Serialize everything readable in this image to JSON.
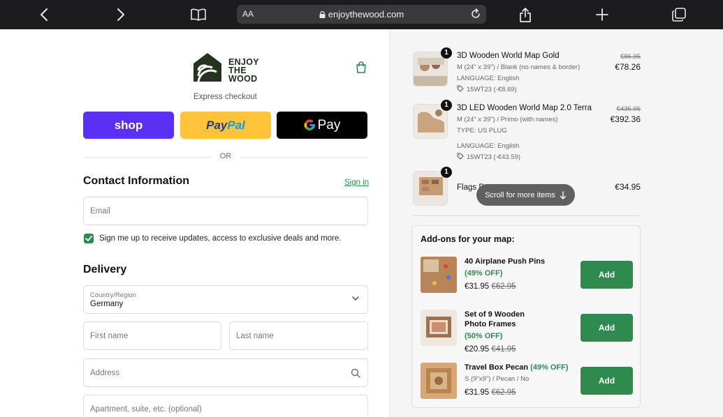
{
  "browser": {
    "text_size": "AA",
    "domain": "enjoythewood.com"
  },
  "header": {
    "logo_lines": [
      "ENJOY",
      "THE",
      "WOOD"
    ]
  },
  "express": {
    "label": "Express checkout",
    "shop": "shop",
    "paypal_a": "Pay",
    "paypal_b": "Pal",
    "gpay": "Pay",
    "or": "OR"
  },
  "contact": {
    "title": "Contact Information",
    "sign_in": "Sign in",
    "email_placeholder": "Email",
    "newsletter": "Sign me up to receive updates, access to exclusive deals and more."
  },
  "delivery": {
    "title": "Delivery",
    "country_label": "Country/Region",
    "country_value": "Germany",
    "first_name": "First name",
    "last_name": "Last name",
    "address": "Address",
    "apartment": "Apartment, suite, etc. (optional)"
  },
  "order": {
    "items": [
      {
        "qty": "1",
        "title": "3D Wooden World Map Gold",
        "variant": "M (24\" x 39\") / Blank (no names & border)",
        "language": "LANGUAGE: English",
        "discount": "15WT23 (-€8.69)",
        "old_price": "€86.95",
        "price": "€78.26"
      },
      {
        "qty": "1",
        "title": "3D LED Wooden World Map 2.0 Terra",
        "variant": "M (24\" x 39\") / Primo (with names)",
        "type": "TYPE: US PLUG",
        "language": "LANGUAGE: English",
        "discount": "15WT23 (-€43.59)",
        "old_price": "€435.95",
        "price": "€392.36"
      },
      {
        "qty": "1",
        "title": "Flags P",
        "price": "€34.95"
      }
    ],
    "scroll_hint": "Scroll for more items"
  },
  "addons": {
    "title": "Add-ons for your map:",
    "add_label": "Add",
    "items": [
      {
        "title_a": "40 Airplane Push Pins",
        "title_b": "",
        "off": "(49% OFF)",
        "price": "€31.95",
        "old_price": "€62.95",
        "meta": ""
      },
      {
        "title_a": "Set of 9 Wooden",
        "title_b": "Photo Frames",
        "off": "(50% OFF)",
        "price": "€20.95",
        "old_price": "€41.95",
        "meta": ""
      },
      {
        "title_a": "Travel Box Pecan",
        "title_b": "",
        "off": "(49% OFF)",
        "price": "€31.95",
        "old_price": "€62.95",
        "meta": "S (9\"x9\") / Pecan / No"
      }
    ]
  },
  "colors": {
    "accent_green": "#2f8a4f",
    "shop_purple": "#5a31f4",
    "paypal_yellow": "#ffc439"
  }
}
